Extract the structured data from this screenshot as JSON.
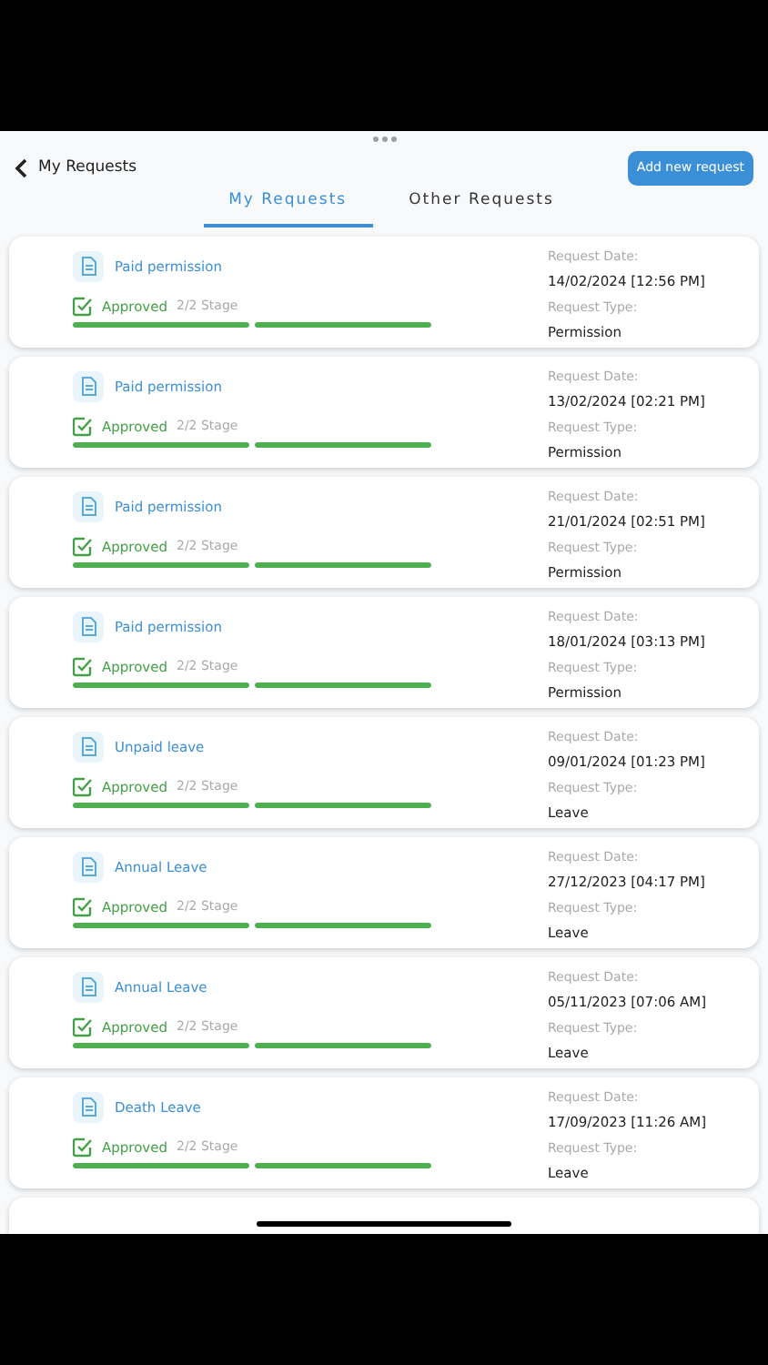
{
  "header": {
    "title": "My Requests",
    "action": "Add new request"
  },
  "tabs": [
    {
      "label": "My Requests",
      "selected": true
    },
    {
      "label": "Other Requests",
      "selected": false
    }
  ],
  "requests": [
    {
      "title": "Paid permission",
      "status": "Approved",
      "stage": "2/2 Stage",
      "stages": [
        {
          "level": 1
        },
        {
          "level": 1
        }
      ],
      "date_label": "Request Date:",
      "date": "14/02/2024 [12:56 PM]",
      "type_label": "Request Type:",
      "type": "Permission"
    },
    {
      "title": "Paid permission",
      "status": "Approved",
      "stage": "2/2 Stage",
      "stages": [
        {
          "level": 1
        },
        {
          "level": 1
        }
      ],
      "date_label": "Request Date:",
      "date": "13/02/2024 [02:21 PM]",
      "type_label": "Request Type:",
      "type": "Permission"
    },
    {
      "title": "Paid permission",
      "status": "Approved",
      "stage": "2/2 Stage",
      "stages": [
        {
          "level": 1
        },
        {
          "level": 1
        }
      ],
      "date_label": "Request Date:",
      "date": "21/01/2024 [02:51 PM]",
      "type_label": "Request Type:",
      "type": "Permission"
    },
    {
      "title": "Paid permission",
      "status": "Approved",
      "stage": "2/2 Stage",
      "stages": [
        {
          "level": 1
        },
        {
          "level": 1
        }
      ],
      "date_label": "Request Date:",
      "date": "18/01/2024 [03:13 PM]",
      "type_label": "Request Type:",
      "type": "Permission"
    },
    {
      "title": "Unpaid leave",
      "status": "Approved",
      "stage": "2/2 Stage",
      "stages": [
        {
          "level": 1
        },
        {
          "level": 1
        }
      ],
      "date_label": "Request Date:",
      "date": "09/01/2024 [01:23 PM]",
      "type_label": "Request Type:",
      "type": "Leave"
    },
    {
      "title": "Annual Leave",
      "status": "Approved",
      "stage": "2/2 Stage",
      "stages": [
        {
          "level": 1
        },
        {
          "level": 1
        }
      ],
      "date_label": "Request Date:",
      "date": "27/12/2023 [04:17 PM]",
      "type_label": "Request Type:",
      "type": "Leave"
    },
    {
      "title": "Annual Leave",
      "status": "Approved",
      "stage": "2/2 Stage",
      "stages": [
        {
          "level": 1
        },
        {
          "level": 1
        }
      ],
      "date_label": "Request Date:",
      "date": "05/11/2023 [07:06 AM]",
      "type_label": "Request Type:",
      "type": "Leave"
    },
    {
      "title": "Death Leave",
      "status": "Approved",
      "stage": "2/2 Stage",
      "stages": [
        {
          "level": 1
        },
        {
          "level": 1
        }
      ],
      "date_label": "Request Date:",
      "date": "17/09/2023 [11:26 AM]",
      "type_label": "Request Type:",
      "type": "Leave"
    }
  ]
}
